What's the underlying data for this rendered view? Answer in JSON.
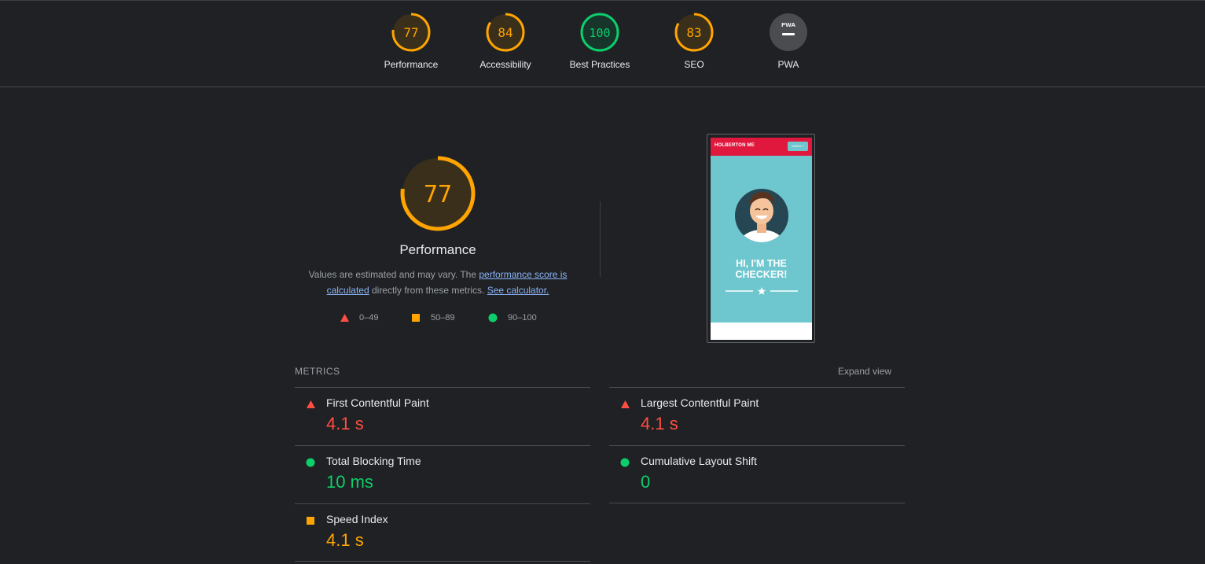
{
  "colors": {
    "fail": "#ff4e42",
    "average": "#ffa400",
    "pass": "#0cce6b",
    "grey": "#9aa0a6"
  },
  "categories": [
    {
      "label": "Performance",
      "score": "77",
      "score_fraction": 0.77,
      "rating": "average"
    },
    {
      "label": "Accessibility",
      "score": "84",
      "score_fraction": 0.84,
      "rating": "average"
    },
    {
      "label": "Best Practices",
      "score": "100",
      "score_fraction": 1.0,
      "rating": "pass"
    },
    {
      "label": "SEO",
      "score": "83",
      "score_fraction": 0.83,
      "rating": "average"
    },
    {
      "label": "PWA",
      "badge_text": "PWA",
      "icon": "pwa-badge-icon",
      "rating": "na"
    }
  ],
  "performance": {
    "score": "77",
    "score_fraction": 0.77,
    "title": "Performance",
    "desc_before": "Values are estimated and may vary. The ",
    "desc_link": "performance score is calculated",
    "desc_middle": " directly from these metrics. ",
    "desc_link2": "See calculator."
  },
  "legend": [
    {
      "icon": "triangle-icon",
      "label": "0–49",
      "color": "fail"
    },
    {
      "icon": "square-icon",
      "label": "50–89",
      "color": "average"
    },
    {
      "icon": "circle-icon",
      "label": "90–100",
      "color": "pass"
    }
  ],
  "screenshot": {
    "brand": "HOLBERTON ME",
    "menu_label": "MENU ≡",
    "hero_line1": "HI, I'M THE",
    "hero_line2": "CHECKER!"
  },
  "metrics_section": {
    "title": "METRICS",
    "expand_label": "Expand view"
  },
  "metrics": [
    {
      "name": "First Contentful Paint",
      "value": "4.1 s",
      "rating": "fail"
    },
    {
      "name": "Largest Contentful Paint",
      "value": "4.1 s",
      "rating": "fail"
    },
    {
      "name": "Total Blocking Time",
      "value": "10 ms",
      "rating": "pass"
    },
    {
      "name": "Cumulative Layout Shift",
      "value": "0",
      "rating": "pass"
    },
    {
      "name": "Speed Index",
      "value": "4.1 s",
      "rating": "average"
    }
  ]
}
